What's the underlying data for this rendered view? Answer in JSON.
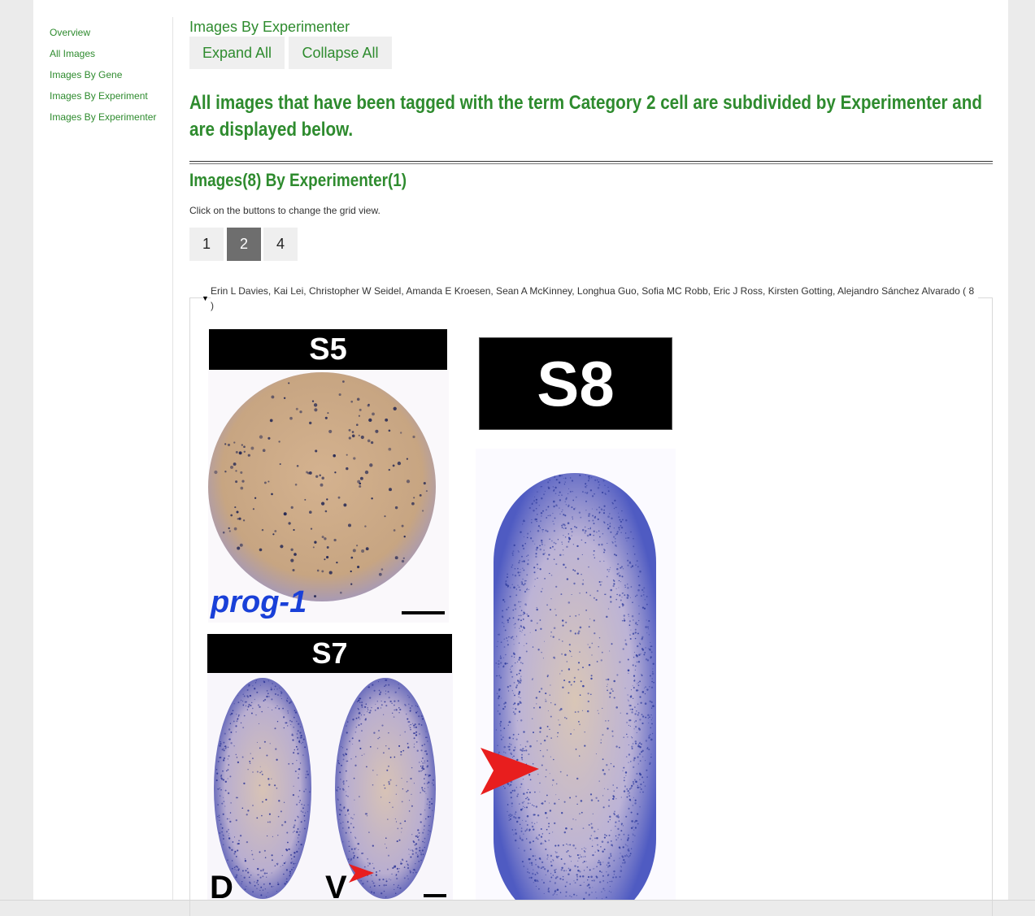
{
  "sidebar": {
    "items": [
      "Overview",
      "All Images",
      "Images By Gene",
      "Images By Experiment",
      "Images By Experimenter"
    ]
  },
  "main": {
    "section_title": "Images By Experimenter",
    "expand_label": "Expand All",
    "collapse_label": "Collapse All",
    "headline": "All images that have been tagged with the term Category 2 cell are subdivided by Experimenter and are displayed below.",
    "subtitle": "Images(8) By Experimenter(1)",
    "hint": "Click on the buttons to change the grid view.",
    "grid_options": [
      "1",
      "2",
      "4"
    ],
    "grid_selected": "2",
    "group_legend": "Erin L Davies, Kai Lei, Christopher W Seidel, Amanda E Kroesen, Sean A McKinney, Longhua Guo, Sofia MC Robb, Eric J Ross, Kirsten Gotting, Alejandro Sánchez Alvarado ( 8 )"
  },
  "images": [
    {
      "stage": "S5",
      "gene": "prog-1"
    },
    {
      "stage": "S8"
    },
    {
      "stage": "S7",
      "left_label": "D",
      "right_label": "V"
    }
  ],
  "colors": {
    "accent": "#2e8b2e",
    "active_button": "#6e6e6e",
    "stain": "#3a44a8",
    "arrow": "#e81e1e"
  }
}
